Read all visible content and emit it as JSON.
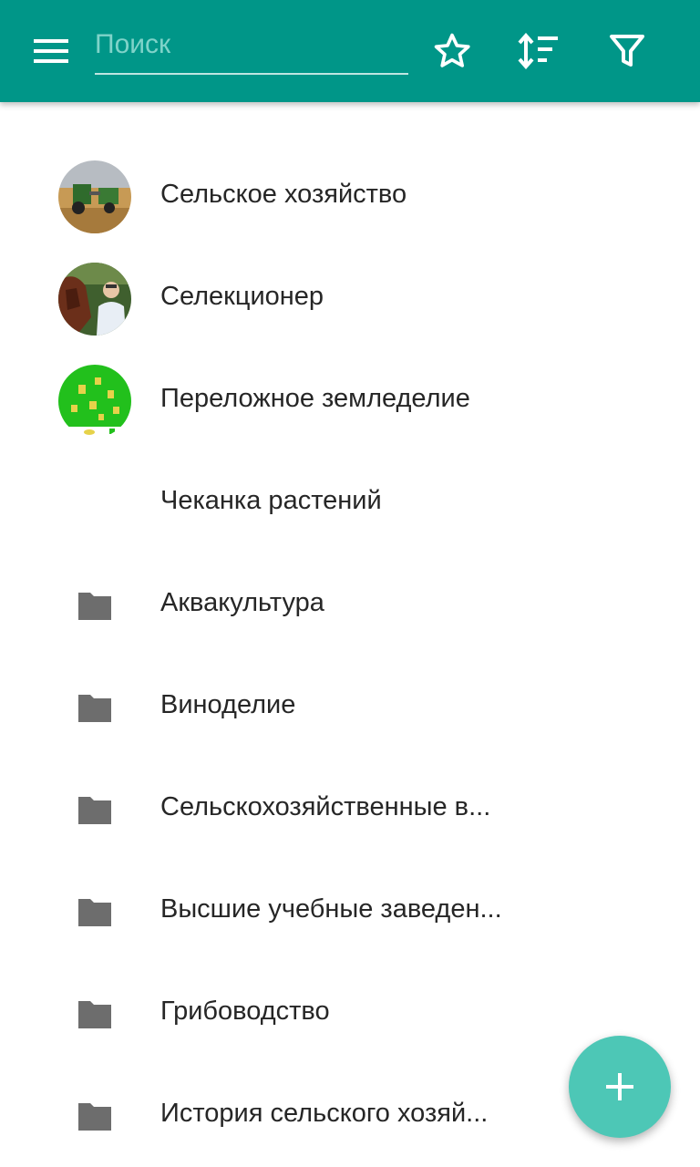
{
  "toolbar": {
    "search_placeholder": "Поиск",
    "menu_icon": "menu-icon",
    "favorites_icon": "star-icon",
    "sort_icon": "sort-icon",
    "filter_icon": "filter-icon",
    "bar_color": "#009688"
  },
  "items": [
    {
      "label": "Сельское хозяйство",
      "icon": "image"
    },
    {
      "label": "Селекционер",
      "icon": "image"
    },
    {
      "label": "Переложное земледелие",
      "icon": "image"
    },
    {
      "label": "Чеканка растений",
      "icon": "none"
    },
    {
      "label": "Аквакультура",
      "icon": "folder-icon"
    },
    {
      "label": "Виноделие",
      "icon": "folder-icon"
    },
    {
      "label": "Сельскохозяйственные в...",
      "icon": "folder-icon"
    },
    {
      "label": "Высшие учебные заведен...",
      "icon": "folder-icon"
    },
    {
      "label": "Грибоводство",
      "icon": "folder-icon"
    },
    {
      "label": "История сельского хозяй...",
      "icon": "folder-icon"
    }
  ],
  "fab": {
    "icon": "plus-icon",
    "color": "#4dc7b6"
  }
}
